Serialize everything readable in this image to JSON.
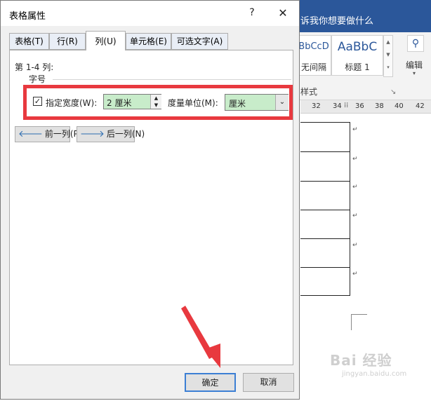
{
  "word": {
    "tell_me": "诉我你想要做什么",
    "styles": [
      {
        "sample": "BbCcD",
        "name": "无间隔"
      },
      {
        "sample": "AaBbC",
        "name": "标题 1"
      }
    ],
    "edit_label": "编辑",
    "styles_group_label": "样式",
    "ruler_numbers": [
      "32",
      "34",
      "36",
      "38",
      "40",
      "42"
    ],
    "watermark_text": "Bai  经验",
    "watermark_sub": "jingyan.baidu.com"
  },
  "dialog": {
    "title": "表格属性",
    "help_label": "?",
    "close_label": "✕",
    "tabs": [
      {
        "label": "表格(T)"
      },
      {
        "label": "行(R)"
      },
      {
        "label": "列(U)"
      },
      {
        "label": "单元格(E)"
      },
      {
        "label": "可选文字(A)"
      }
    ],
    "active_tab": "列(U)",
    "columns_label": "第 1-4 列:",
    "size_label": "字号",
    "width_checkbox": {
      "checked": true,
      "label": "指定宽度(W):"
    },
    "width_value": "2 厘米",
    "unit_label": "度量单位(M):",
    "unit_value": "厘米",
    "prev_column_label": "前一列(P)",
    "next_column_label": "后一列(N)",
    "ok_label": "确定",
    "cancel_label": "取消"
  },
  "colors": {
    "word_blue": "#2b579a",
    "highlight_red": "#e8393f",
    "input_green": "#c8ecca",
    "ok_border": "#3c7fd4"
  }
}
